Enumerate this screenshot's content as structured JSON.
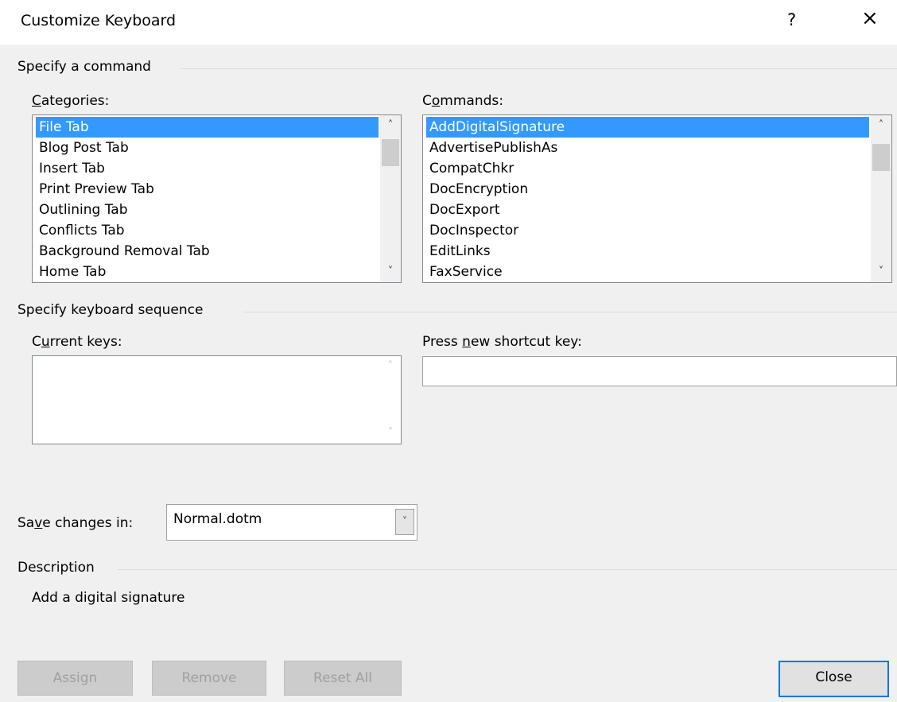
{
  "window": {
    "title": "Customize Keyboard",
    "help": "?",
    "close": "×"
  },
  "command_section": {
    "header": "Specify a command",
    "categories_label_ul": "C",
    "categories_label_rest": "ategories:",
    "commands_label_pre": "C",
    "commands_label_ul": "o",
    "commands_label_rest": "mmands:",
    "categories": [
      "File Tab",
      "Blog Post Tab",
      "Insert Tab",
      "Print Preview Tab",
      "Outlining Tab",
      "Conflicts Tab",
      "Background Removal Tab",
      "Home Tab"
    ],
    "commands": [
      "AddDigitalSignature",
      "AdvertisePublishAs",
      "CompatChkr",
      "DocEncryption",
      "DocExport",
      "DocInspector",
      "EditLinks",
      "FaxService"
    ]
  },
  "keyboard_section": {
    "header": "Specify keyboard sequence",
    "current_keys_pre": "C",
    "current_keys_ul": "u",
    "current_keys_rest": "rrent keys:",
    "press_new_pre": "Press ",
    "press_new_ul": "n",
    "press_new_rest": "ew shortcut key:",
    "current_keys_value": "",
    "new_shortcut_value": ""
  },
  "save": {
    "label_pre": "Sa",
    "label_ul": "v",
    "label_rest": "e changes in:",
    "value": "Normal.dotm"
  },
  "description": {
    "header": "Description",
    "text": "Add a digital signature"
  },
  "buttons": {
    "assign": "Assign",
    "remove": "Remove",
    "reset_all": "Reset All",
    "close": "Close"
  },
  "icons": {
    "scroll_up": "chevron-up-icon",
    "scroll_down": "chevron-down-icon",
    "dropdown": "chevron-down-icon"
  },
  "colors": {
    "selection": "#3399ff",
    "close_border": "#0078d7"
  }
}
